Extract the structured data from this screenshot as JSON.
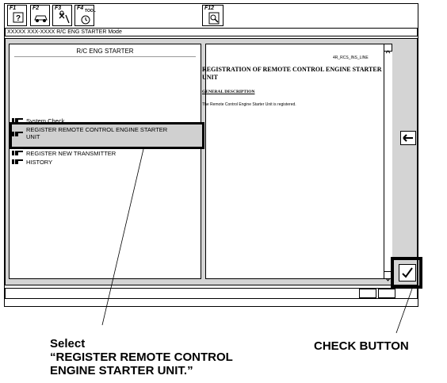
{
  "toolbar": {
    "f1_label": "F1",
    "f2_label": "F2",
    "f3_label": "F3",
    "f4_label": "F4",
    "f4_sub": "TOOL",
    "f12_label": "F12"
  },
  "mode_bar": {
    "text": "XXXXX XXX-XXXX R/C ENG STARTER Mode"
  },
  "left_panel": {
    "title": "R/C ENG STARTER",
    "items": [
      {
        "label": "System Check"
      },
      {
        "label": "REGISTER REMOTE CONTROL ENGINE STARTER UNIT"
      },
      {
        "label": "REGISTER NEW TRANSMITTER"
      },
      {
        "label": "HISTORY"
      }
    ]
  },
  "doc_panel": {
    "code": "4R_RCS_INS_LINE",
    "heading": "REGISTRATION OF REMOTE CONTROL ENGINE STARTER UNIT",
    "section": "GENERAL DESCRIPTION",
    "body": "The Remote Control Engine Starter Unit is registered."
  },
  "side_buttons": {
    "back_icon": "left-arrow-icon",
    "check_icon": "checkmark-icon"
  },
  "callouts": {
    "select_line1": "Select",
    "select_line2": "“REGISTER REMOTE CONTROL",
    "select_line3": "ENGINE STARTER UNIT.”",
    "check": "CHECK BUTTON"
  },
  "colors": {
    "panel_bg": "#d4d4d4",
    "highlight_bg": "#d0d0d0"
  }
}
